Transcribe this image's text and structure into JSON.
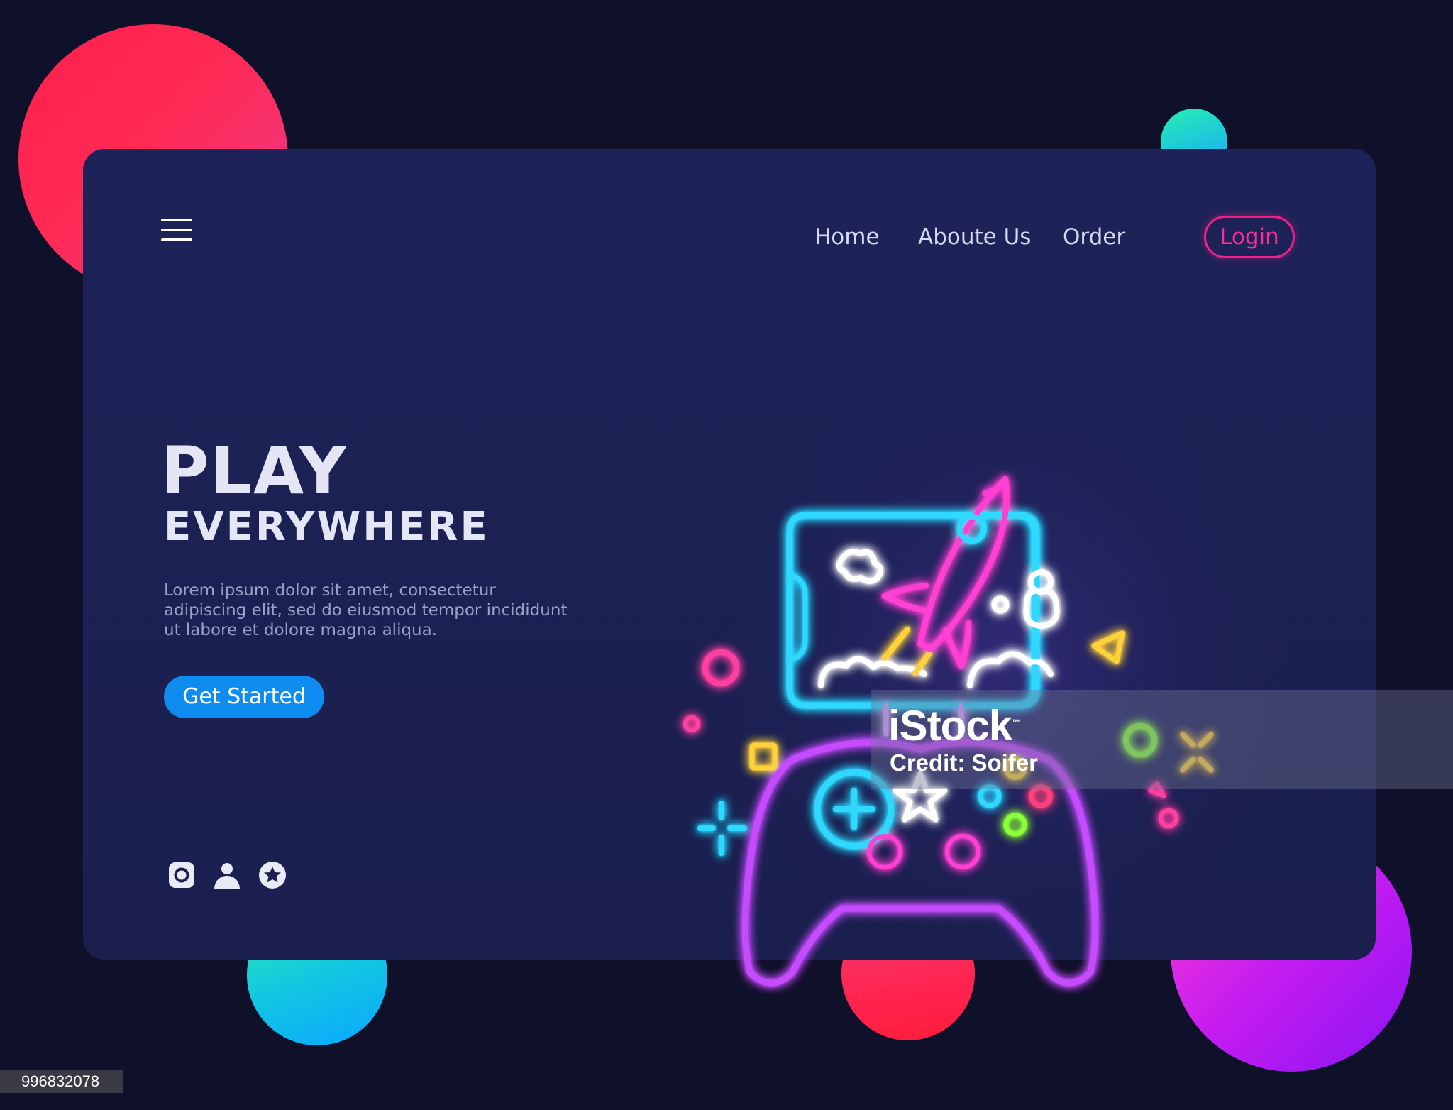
{
  "nav": {
    "home": "Home",
    "about": "Aboute Us",
    "order": "Order",
    "login": "Login"
  },
  "hero": {
    "title": "PLAY",
    "subtitle": "EVERYWHERE",
    "description": "Lorem ipsum dolor sit amet, consectetur adipiscing elit, sed do eiusmod tempor incididunt ut labore et dolore magna aliqua.",
    "cta": "Get Started"
  },
  "icons": {
    "menu": "hamburger-menu-icon",
    "social": [
      "instagram-icon",
      "user-icon",
      "star-badge-icon"
    ]
  },
  "watermark": {
    "logo": "iStock",
    "tm": "™",
    "credit": "Credit: Soifer",
    "image_id": "996832078"
  },
  "colors": {
    "background": "#0f1029",
    "card": "#1b2052",
    "accent_pink": "#f0208a",
    "accent_blue": "#0f8cf0",
    "neon_cyan": "#2fd8ff",
    "neon_magenta": "#ff3fd2",
    "neon_purple": "#b93cff",
    "neon_yellow": "#ffd23a",
    "neon_green": "#8cff3a"
  }
}
